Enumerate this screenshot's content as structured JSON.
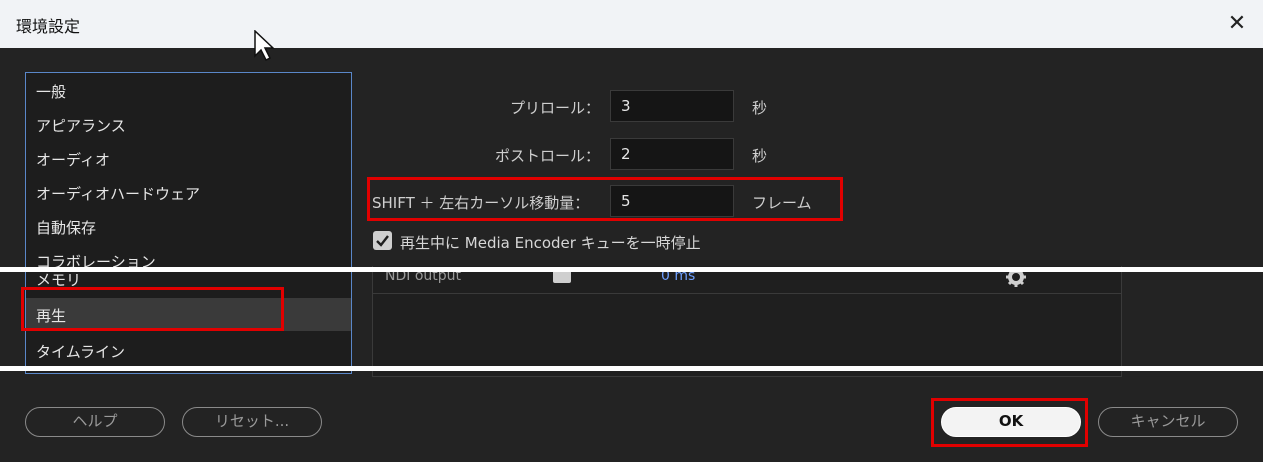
{
  "window": {
    "title": "環境設定",
    "close_glyph": "✕"
  },
  "categories": [
    {
      "label": "一般"
    },
    {
      "label": "アピアランス"
    },
    {
      "label": "オーディオ"
    },
    {
      "label": "オーディオハードウェア"
    },
    {
      "label": "自動保存"
    },
    {
      "label": "コラボレーション"
    },
    {
      "label": "メモリ"
    },
    {
      "label": "再生",
      "selected": true
    },
    {
      "label": "タイムライン"
    }
  ],
  "playback": {
    "preroll": {
      "label": "プリロール：",
      "value": "3",
      "unit": "秒"
    },
    "postroll": {
      "label": "ポストロール：",
      "value": "2",
      "unit": "秒"
    },
    "shift_move": {
      "label": "SHIFT ＋ 左右カーソル移動量：",
      "value": "5",
      "unit": "フレーム"
    },
    "pause_encoder": {
      "label": "再生中に Media Encoder キューを一時停止",
      "checked": true
    }
  },
  "table": {
    "row_label": "NDI output",
    "ms_value": "0 ms"
  },
  "footer": {
    "help": "ヘルプ",
    "reset": "リセット...",
    "ok": "OK",
    "cancel": "キャンセル"
  },
  "colors": {
    "highlight": "#e10000",
    "selection_border": "#5a87c9"
  }
}
